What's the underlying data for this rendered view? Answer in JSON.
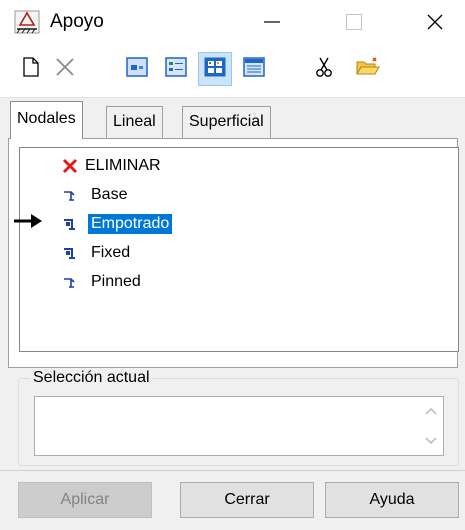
{
  "window": {
    "title": "Apoyo",
    "controls": [
      "minimize-icon",
      "maximize-icon",
      "close-icon"
    ]
  },
  "toolbar": {
    "buttons": [
      {
        "icon": "new-document-icon"
      },
      {
        "icon": "delete-x-icon",
        "enabled": false
      },
      {
        "icon": "view-small-icons-icon"
      },
      {
        "icon": "view-details-icon"
      },
      {
        "icon": "view-grid-icon",
        "pressed": true
      },
      {
        "icon": "view-list-icon"
      },
      {
        "icon": "cut-scissors-icon"
      },
      {
        "icon": "open-folder-icon"
      }
    ]
  },
  "tabs": [
    {
      "label": "Nodales",
      "active": true
    },
    {
      "label": "Lineal",
      "active": false
    },
    {
      "label": "Superficial",
      "active": false
    }
  ],
  "list": {
    "items": [
      {
        "label": "ELIMINAR",
        "icon": "red-x-icon",
        "selected": false
      },
      {
        "label": "Base",
        "icon": "support-base-icon",
        "selected": false
      },
      {
        "label": "Empotrado",
        "icon": "support-fixed-icon",
        "selected": true
      },
      {
        "label": "Fixed",
        "icon": "support-fixed-icon",
        "selected": false
      },
      {
        "label": "Pinned",
        "icon": "support-base-icon",
        "selected": false
      }
    ],
    "current_marker": "arrow-right-icon"
  },
  "selection": {
    "legend": "Selección actual",
    "value": ""
  },
  "buttons": {
    "apply": "Aplicar",
    "close": "Cerrar",
    "help": "Ayuda"
  },
  "colors": {
    "selection_bg": "#0078d7",
    "toolbar_icon_blue": "#1e66c8",
    "delete_red": "#e21b1b"
  }
}
